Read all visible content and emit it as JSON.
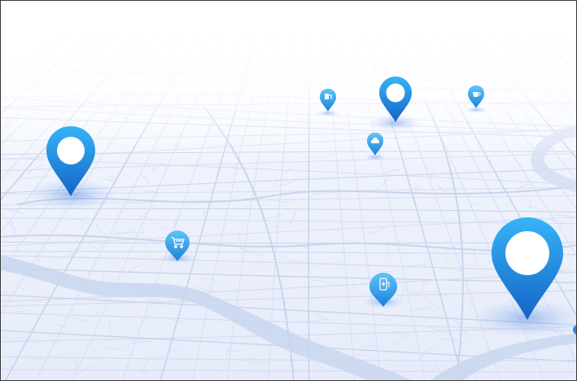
{
  "map": {
    "colors": {
      "sky_top": "#ffffff",
      "ground": "#e9eefb",
      "street": "#c9d3ec",
      "street_minor": "#d7def2",
      "river": "#c6d4ee",
      "pin_light": "#34b0f5",
      "pin_dark": "#1565c8",
      "pin_glow": "#3f7fe0"
    },
    "markers": [
      {
        "id": "marker-large-left",
        "kind": "location",
        "icon": "pin-icon"
      },
      {
        "id": "marker-top-center",
        "kind": "location",
        "icon": "pin-icon"
      },
      {
        "id": "marker-large-right",
        "kind": "location",
        "icon": "pin-icon"
      },
      {
        "id": "poi-gas-station",
        "kind": "poi",
        "icon": "gas-station-icon"
      },
      {
        "id": "poi-cafe",
        "kind": "poi",
        "icon": "coffee-icon"
      },
      {
        "id": "poi-car",
        "kind": "poi",
        "icon": "car-icon"
      },
      {
        "id": "poi-shopping",
        "kind": "poi",
        "icon": "shopping-cart-icon"
      },
      {
        "id": "poi-ev-charging",
        "kind": "poi",
        "icon": "ev-charging-icon"
      }
    ]
  }
}
